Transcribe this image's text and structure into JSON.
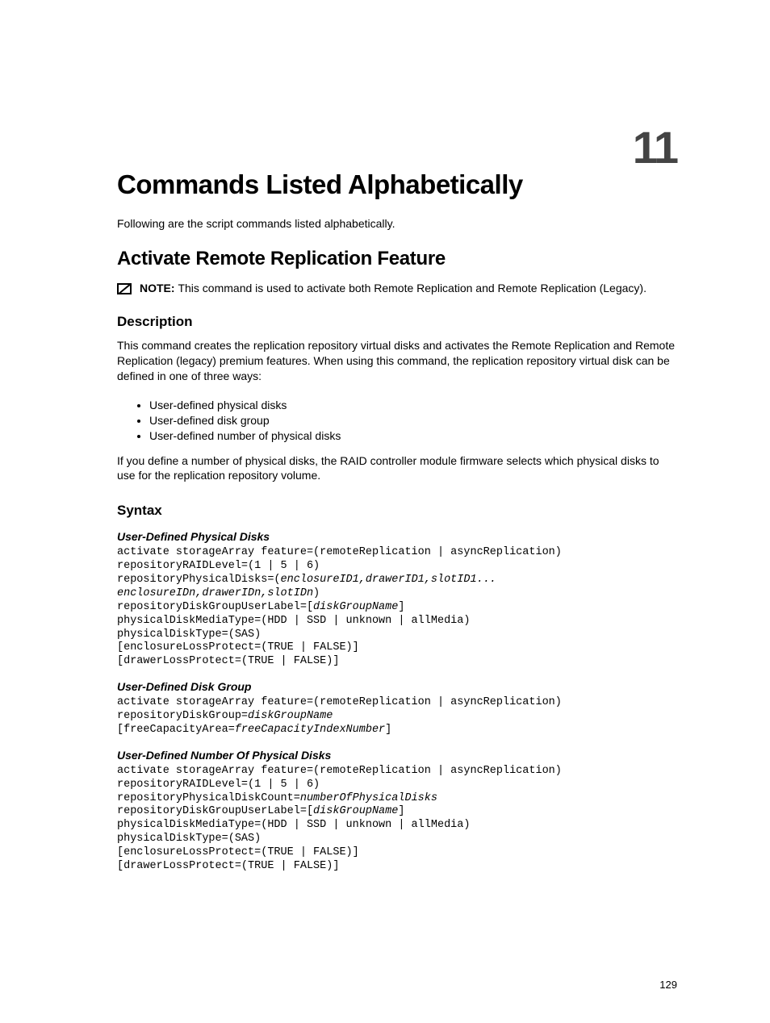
{
  "chapter_number": "11",
  "title": "Commands Listed Alphabetically",
  "intro": "Following are the script commands listed alphabetically.",
  "section_title": "Activate Remote Replication Feature",
  "note": {
    "label": "NOTE: ",
    "text": "This command is used to activate both Remote Replication and Remote Replication (Legacy)."
  },
  "description": {
    "heading": "Description",
    "para1": "This command creates the replication repository virtual disks and activates the Remote Replication and Remote Replication (legacy) premium features. When using this command, the replication repository virtual disk can be defined in one of three ways:",
    "bullets": [
      "User-defined physical disks",
      "User-defined disk group",
      "User-defined number of physical disks"
    ],
    "para2": "If you define a number of physical disks, the RAID controller module firmware selects which physical disks to use for the replication repository volume."
  },
  "syntax": {
    "heading": "Syntax",
    "block1": {
      "title": "User-Defined Physical Disks",
      "l1": "activate storageArray feature=(remoteReplication | asyncReplication)",
      "l2": "repositoryRAIDLevel=(1 | 5 | 6)",
      "l3a": "repositoryPhysicalDisks=(",
      "l3b": "enclosureID1,drawerID1,slotID1...",
      "l4": "enclosureIDn,drawerIDn,slotIDn",
      "l4b": ")",
      "l5a": "repositoryDiskGroupUserLabel=[",
      "l5b": "diskGroupName",
      "l5c": "]",
      "l6": "physicalDiskMediaType=(HDD | SSD | unknown | allMedia)",
      "l7": "physicalDiskType=(SAS)",
      "l8": "[enclosureLossProtect=(TRUE | FALSE)]",
      "l9": "[drawerLossProtect=(TRUE | FALSE)]"
    },
    "block2": {
      "title": "User-Defined Disk Group",
      "l1": "activate storageArray feature=(remoteReplication | asyncReplication)",
      "l2a": "repositoryDiskGroup=",
      "l2b": "diskGroupName",
      "l3a": "[freeCapacityArea=",
      "l3b": "freeCapacityIndexNumber",
      "l3c": "]"
    },
    "block3": {
      "title": "User-Defined Number Of Physical Disks",
      "l1": "activate storageArray feature=(remoteReplication | asyncReplication)",
      "l2": "repositoryRAIDLevel=(1 | 5 | 6)",
      "l3a": "repositoryPhysicalDiskCount=",
      "l3b": "numberOfPhysicalDisks",
      "l4a": "repositoryDiskGroupUserLabel=[",
      "l4b": "diskGroupName",
      "l4c": "]",
      "l5": "physicalDiskMediaType=(HDD | SSD | unknown | allMedia)",
      "l6": "physicalDiskType=(SAS)",
      "l7": "[enclosureLossProtect=(TRUE | FALSE)]",
      "l8": "[drawerLossProtect=(TRUE | FALSE)]"
    }
  },
  "page_number": "129"
}
